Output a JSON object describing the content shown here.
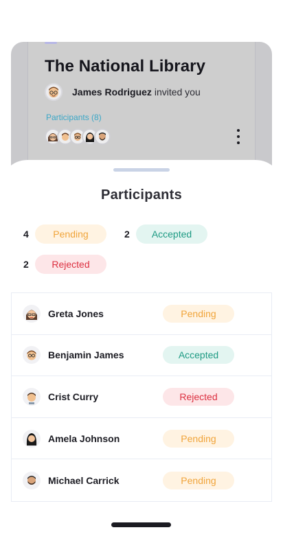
{
  "event": {
    "title": "The National Library",
    "inviter_name": "James Rodriguez",
    "inviter_text": "invited you",
    "participants_link": "Participants (8)"
  },
  "sheet": {
    "title": "Participants",
    "summary": [
      {
        "count": "4",
        "label": "Pending",
        "status": "pending"
      },
      {
        "count": "2",
        "label": "Accepted",
        "status": "accepted"
      },
      {
        "count": "2",
        "label": "Rejected",
        "status": "rejected"
      }
    ],
    "participants": [
      {
        "name": "Greta Jones",
        "status": "Pending",
        "avatar_icon": "avatar-woman-glasses-icon"
      },
      {
        "name": "Benjamin James",
        "status": "Accepted",
        "avatar_icon": "avatar-man-glasses-icon"
      },
      {
        "name": "Crist Curry",
        "status": "Rejected",
        "avatar_icon": "avatar-man-icon"
      },
      {
        "name": "Amela Johnson",
        "status": "Pending",
        "avatar_icon": "avatar-woman-long-hair-icon"
      },
      {
        "name": "Michael Carrick",
        "status": "Pending",
        "avatar_icon": "avatar-man-beard-icon"
      }
    ]
  },
  "colors": {
    "pending_text": "#f0a43a",
    "pending_bg": "#fff3e2",
    "accepted_text": "#1d9a83",
    "accepted_bg": "#e3f5f1",
    "rejected_text": "#dc3040",
    "rejected_bg": "#fde6e8",
    "link": "#3aa7c7"
  }
}
